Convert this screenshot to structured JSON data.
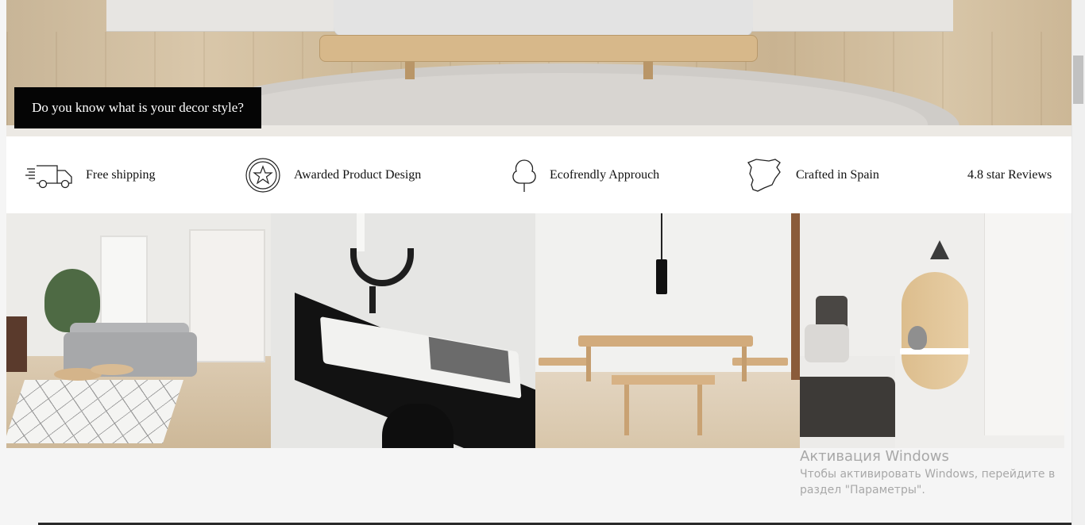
{
  "hero": {
    "cta_label": "Do you know what is your decor style?"
  },
  "features": [
    {
      "icon": "delivery-truck-icon",
      "label": "Free shipping"
    },
    {
      "icon": "award-star-badge-icon",
      "label": "Awarded Product Design"
    },
    {
      "icon": "tree-icon",
      "label": "Ecofrendly Approuch"
    },
    {
      "icon": "spain-map-icon",
      "label": "Crafted in Spain"
    },
    {
      "icon": "",
      "label": "4.8 star Reviews"
    }
  ],
  "gallery": [
    {
      "subject": "living room with grey sofa and round wooden coffee tables"
    },
    {
      "subject": "black desk with open magazine and candle holder"
    },
    {
      "subject": "wooden dining table with benches and pendant lamp"
    },
    {
      "subject": "bedroom with oval wooden wall shelf and vase"
    }
  ],
  "watermark": {
    "title": "Активация Windows",
    "text": "Чтобы активировать Windows, перейдите в раздел \"Параметры\"."
  },
  "colors": {
    "cta_background": "#050505",
    "features_background": "#ffffff",
    "page_background": "#f5f5f5"
  }
}
